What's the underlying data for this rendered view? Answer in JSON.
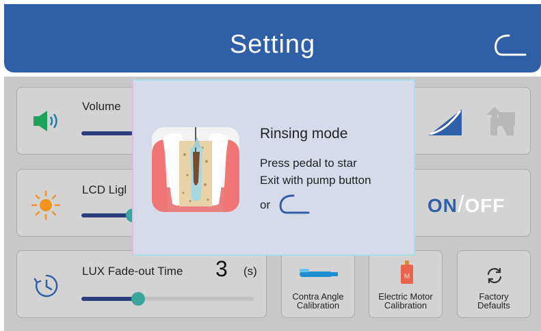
{
  "header": {
    "title": "Setting",
    "back_icon": "return-hook-icon"
  },
  "volume": {
    "label": "Volume",
    "level": 0.3,
    "icon": "speaker-icon"
  },
  "lcd": {
    "label": "LCD Ligl",
    "level": 0.3,
    "icon": "sun-icon"
  },
  "lux": {
    "label": "LUX Fade-out Time",
    "value": "3",
    "unit": "(s)",
    "level": 0.33,
    "icon": "timer-icon"
  },
  "power_curve": {
    "icons": [
      "power-ramp-icon",
      "step-up-icon"
    ]
  },
  "toggle": {
    "on_label": "ON",
    "separator": "/",
    "off_label": "OFF",
    "on_color": "#2f5fa6",
    "off_color": "#ffffff"
  },
  "buttons": {
    "contra": {
      "line1": "Contra Angle",
      "line2": "Calibration"
    },
    "motor": {
      "line1": "Electric Motor",
      "line2": "Calibration"
    },
    "factory": {
      "line1": "Factory",
      "line2": "Defaults"
    }
  },
  "modal": {
    "title": "Rinsing mode",
    "line1": "Press pedal to star",
    "line2": "Exit with pump button",
    "or_label": "or",
    "illustration": "tooth-rinsing-illustration",
    "return_icon": "return-hook-icon"
  },
  "colors": {
    "header": "#2f5fa6",
    "accent": "#3ba59b",
    "slider_fill": "#2a3e80"
  }
}
